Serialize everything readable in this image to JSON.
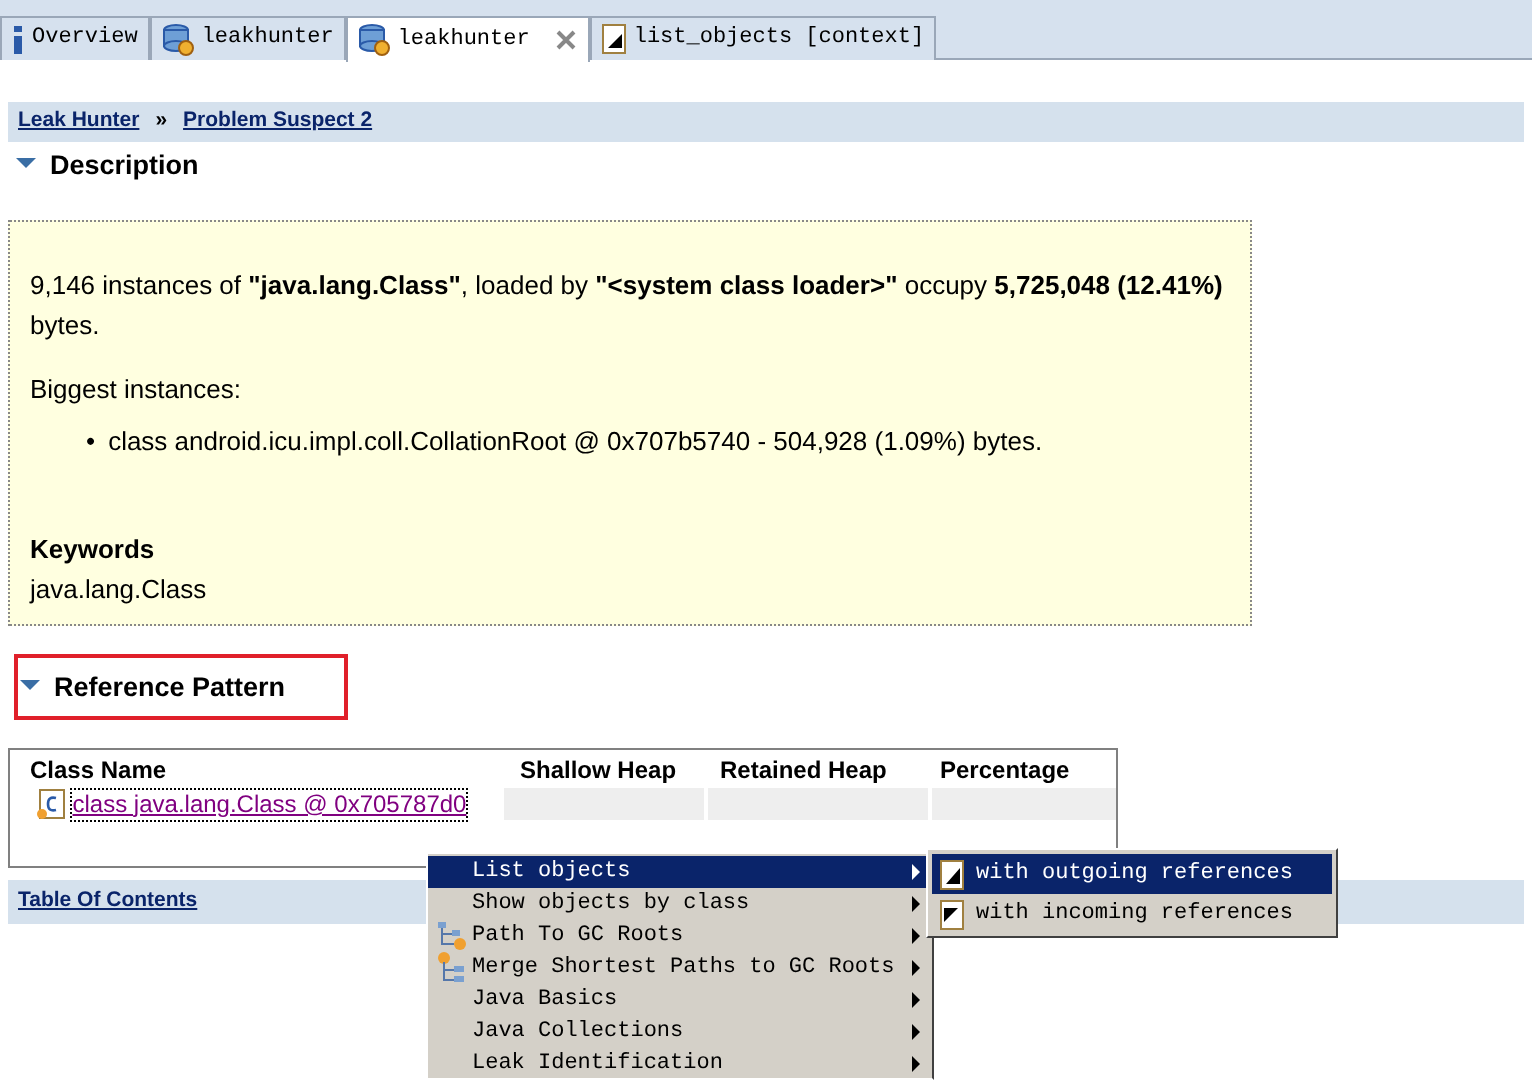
{
  "tabs": [
    {
      "label": "Overview",
      "kind": "info",
      "selected": false,
      "closable": false
    },
    {
      "label": "leakhunter",
      "kind": "heap",
      "selected": false,
      "closable": false
    },
    {
      "label": "leakhunter",
      "kind": "heap",
      "selected": true,
      "closable": true
    },
    {
      "label": "list_objects [context]",
      "kind": "doc",
      "selected": false,
      "closable": false
    }
  ],
  "breadcrumb": [
    {
      "label": "Leak Hunter"
    },
    {
      "label": "Problem Suspect 2"
    }
  ],
  "breadcrumb_separator": "»",
  "description": {
    "title": "Description",
    "expanded": true,
    "summary": "9,146 instances of **\"java.lang.Class\"**, loaded by **\"<system class loader>\"** occupy **5,725,048 (12.41%)** bytes.",
    "biggest_label": "Biggest instances:",
    "bullet": "•",
    "biggest": [
      "class android.icu.impl.coll.CollationRoot @ 0x707b5740 - 504,928 (1.09%) bytes."
    ],
    "keywords_label": "Keywords",
    "keywords": "java.lang.Class"
  },
  "reference_pattern": {
    "title": "Reference Pattern",
    "expanded": true,
    "highlighted": true,
    "columns": [
      "Class Name",
      "Shallow Heap",
      "Retained Heap",
      "Percentage"
    ],
    "rows": [
      {
        "class_name": "class java.lang.Class @ 0x705787d0"
      }
    ]
  },
  "table_of_contents": "Table Of Contents",
  "context_menu": [
    {
      "label": "List objects",
      "kind": "plain",
      "selected": true,
      "submenu": true
    },
    {
      "label": "Show objects by class",
      "kind": "plain",
      "selected": false,
      "submenu": true
    },
    {
      "label": "Path To GC Roots",
      "kind": "tree",
      "selected": false,
      "submenu": true
    },
    {
      "label": "Merge Shortest Paths to GC Roots",
      "kind": "tree-merge",
      "selected": false,
      "submenu": true
    },
    {
      "label": "Java Basics",
      "kind": "plain",
      "selected": false,
      "submenu": true
    },
    {
      "label": "Java Collections",
      "kind": "plain",
      "selected": false,
      "submenu": true
    },
    {
      "label": "Leak Identification",
      "kind": "plain",
      "selected": false,
      "submenu": true
    }
  ],
  "submenu": [
    {
      "label": "with outgoing references",
      "kind": "outgoing",
      "selected": true
    },
    {
      "label": "with incoming references",
      "kind": "incoming",
      "selected": false
    }
  ]
}
